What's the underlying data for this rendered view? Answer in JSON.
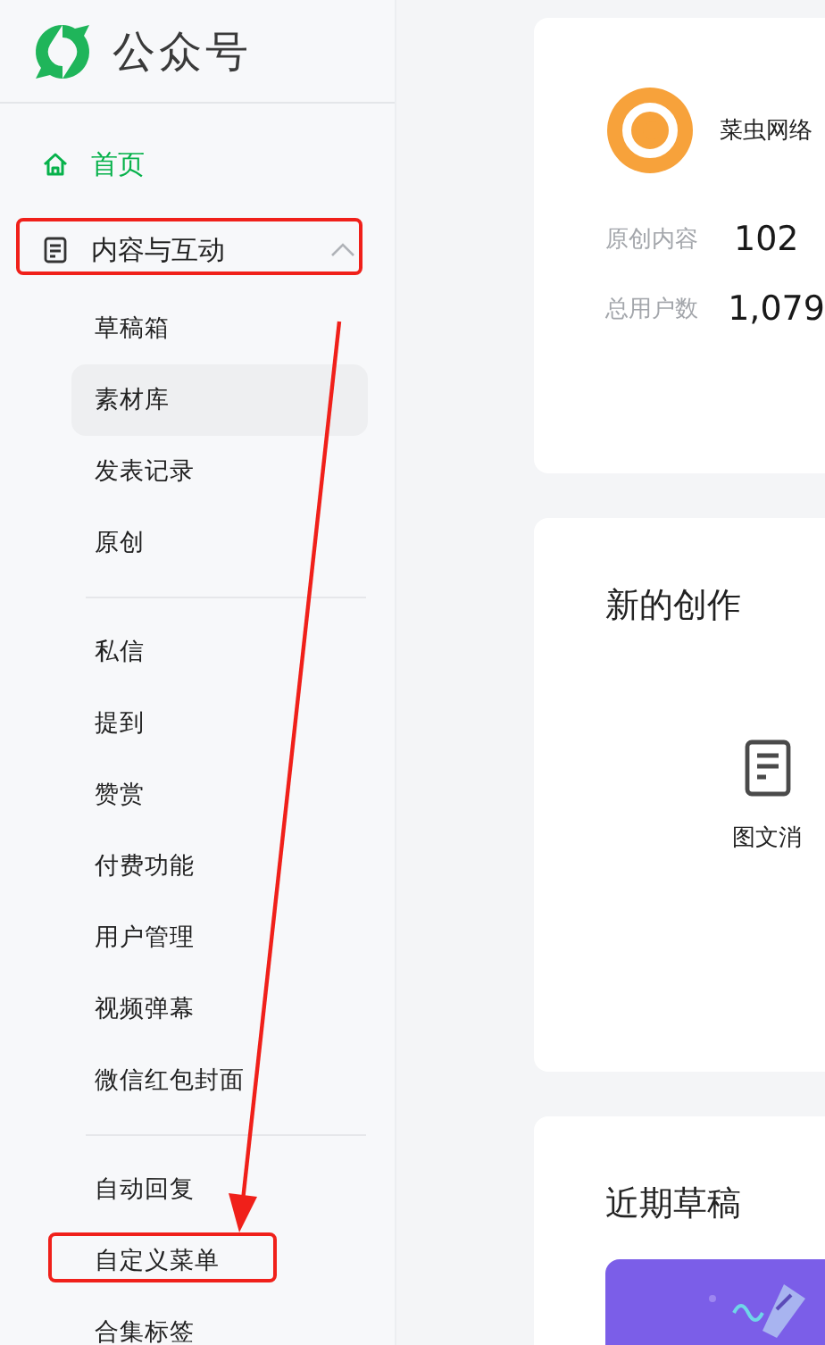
{
  "brand": {
    "name": "公众号"
  },
  "nav": [
    {
      "kind": "link",
      "label": "首页",
      "active": true,
      "annotated": false
    },
    {
      "kind": "group",
      "label": "内容与互动",
      "active": false,
      "expanded": true,
      "annotated": true,
      "children": [
        {
          "items": [
            {
              "label": "草稿箱",
              "selected": false,
              "annotated": false
            },
            {
              "label": "素材库",
              "selected": true,
              "annotated": false
            },
            {
              "label": "发表记录",
              "selected": false,
              "annotated": false
            },
            {
              "label": "原创",
              "selected": false,
              "annotated": false
            }
          ]
        },
        {
          "items": [
            {
              "label": "私信",
              "selected": false,
              "annotated": false
            },
            {
              "label": "提到",
              "selected": false,
              "annotated": false
            },
            {
              "label": "赞赏",
              "selected": false,
              "annotated": false
            },
            {
              "label": "付费功能",
              "selected": false,
              "annotated": false
            },
            {
              "label": "用户管理",
              "selected": false,
              "annotated": false
            },
            {
              "label": "视频弹幕",
              "selected": false,
              "annotated": false
            },
            {
              "label": "微信红包封面",
              "selected": false,
              "annotated": false
            }
          ]
        },
        {
          "items": [
            {
              "label": "自动回复",
              "selected": false,
              "annotated": false
            },
            {
              "label": "自定义菜单",
              "selected": false,
              "annotated": true
            },
            {
              "label": "合集标签",
              "selected": false,
              "annotated": false
            }
          ]
        }
      ]
    }
  ],
  "account": {
    "name": "菜虫网络",
    "stats": [
      {
        "label": "原创内容",
        "value": "102"
      },
      {
        "label": "总用户数",
        "value": "1,079"
      }
    ]
  },
  "create": {
    "title": "新的创作",
    "options": [
      {
        "label": "图文消"
      }
    ]
  },
  "drafts": {
    "title": "近期草稿"
  }
}
